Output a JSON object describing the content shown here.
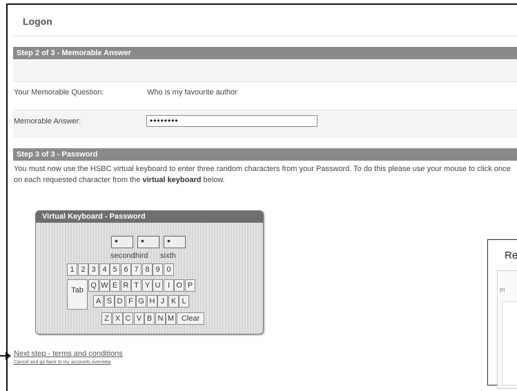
{
  "page": {
    "title": "Logon"
  },
  "step2": {
    "header": "Step 2 of 3 - Memorable Answer",
    "question_label": "Your Memorable Question:",
    "question_value": "Who is my favourite author",
    "answer_label": "Memorable Answer:",
    "answer_value": "••••••••"
  },
  "step3": {
    "header": "Step 3 of 3 - Password",
    "instructions_part1": "You must now use the HSBC virtual keyboard to enter three random characters from your Password. To do this please use your mouse to click once on each requested character from the ",
    "instructions_bold": "virtual keyboard",
    "instructions_part2": " below."
  },
  "keyboard": {
    "title": "Virtual Keyboard - Password",
    "char_boxes": [
      {
        "value": "•",
        "label": "second"
      },
      {
        "value": "•",
        "label": "third"
      },
      {
        "value": "•",
        "label": "sixth"
      }
    ],
    "row_digits": [
      "1",
      "2",
      "3",
      "4",
      "5",
      "6",
      "7",
      "8",
      "9",
      "0"
    ],
    "row_qwerty": [
      "Q",
      "W",
      "E",
      "R",
      "T",
      "Y",
      "U",
      "I",
      "O",
      "P"
    ],
    "row_asdf": [
      "A",
      "S",
      "D",
      "F",
      "G",
      "H",
      "J",
      "K",
      "L"
    ],
    "row_zxcv": [
      "Z",
      "X",
      "C",
      "V",
      "B",
      "N",
      "M"
    ],
    "tab_label": "Tab",
    "clear_label": "Clear"
  },
  "links": {
    "next": "Next step - terms and conditions",
    "cancel": "Cancel and go back to my accounts overview"
  },
  "panel": {
    "title": "Re",
    "sub": "Pl"
  }
}
